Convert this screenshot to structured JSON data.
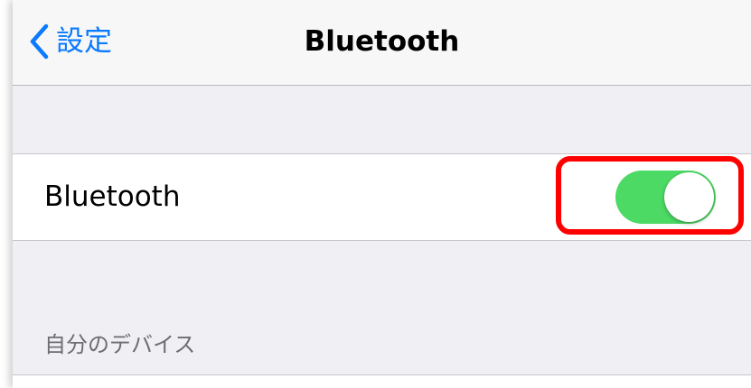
{
  "navbar": {
    "back_label": "設定",
    "back_icon": "chevron-left-icon",
    "title": "Bluetooth"
  },
  "bluetooth_cell": {
    "label": "Bluetooth",
    "toggle_state": "on",
    "toggle_color": "#4cd964",
    "highlight_color": "#ff0000"
  },
  "devices_section": {
    "header": "自分のデバイス"
  },
  "colors": {
    "accent": "#0a7aff",
    "background": "#efeff4"
  }
}
